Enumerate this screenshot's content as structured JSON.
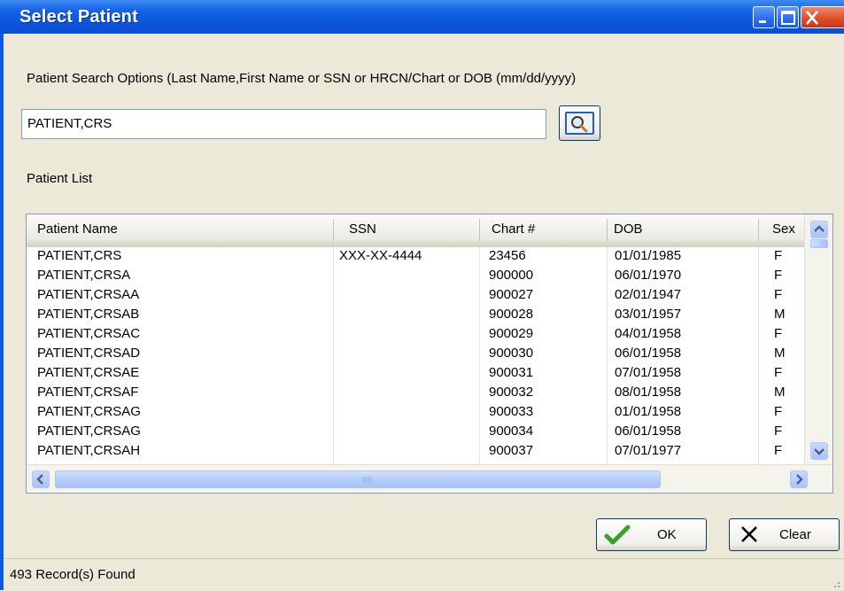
{
  "window": {
    "title": "Select Patient",
    "buttons": [
      "minimize-icon",
      "maximize-icon",
      "close-icon"
    ]
  },
  "search": {
    "options_label": "Patient Search Options (Last Name,First Name or SSN or HRCN/Chart or DOB (mm/dd/yyyy)",
    "value": "PATIENT,CRS",
    "button_icon": "magnifier-icon"
  },
  "list": {
    "label": "Patient List",
    "columns": [
      "Patient Name",
      "SSN",
      "Chart #",
      "DOB",
      "Sex"
    ],
    "rows": [
      {
        "name": "PATIENT,CRS",
        "ssn": "XXX-XX-4444",
        "chart": "23456",
        "dob": "01/01/1985",
        "sex": "F"
      },
      {
        "name": "PATIENT,CRSA",
        "ssn": "",
        "chart": "900000",
        "dob": "06/01/1970",
        "sex": "F"
      },
      {
        "name": "PATIENT,CRSAA",
        "ssn": "",
        "chart": "900027",
        "dob": "02/01/1947",
        "sex": "F"
      },
      {
        "name": "PATIENT,CRSAB",
        "ssn": "",
        "chart": "900028",
        "dob": "03/01/1957",
        "sex": "M"
      },
      {
        "name": "PATIENT,CRSAC",
        "ssn": "",
        "chart": "900029",
        "dob": "04/01/1958",
        "sex": "F"
      },
      {
        "name": "PATIENT,CRSAD",
        "ssn": "",
        "chart": "900030",
        "dob": "06/01/1958",
        "sex": "M"
      },
      {
        "name": "PATIENT,CRSAE",
        "ssn": "",
        "chart": "900031",
        "dob": "07/01/1958",
        "sex": "F"
      },
      {
        "name": "PATIENT,CRSAF",
        "ssn": "",
        "chart": "900032",
        "dob": "08/01/1958",
        "sex": "M"
      },
      {
        "name": "PATIENT,CRSAG",
        "ssn": "",
        "chart": "900033",
        "dob": "01/01/1958",
        "sex": "F"
      },
      {
        "name": "PATIENT,CRSAG",
        "ssn": "",
        "chart": "900034",
        "dob": "06/01/1958",
        "sex": "F"
      },
      {
        "name": "PATIENT,CRSAH",
        "ssn": "",
        "chart": "900037",
        "dob": "07/01/1977",
        "sex": "F"
      }
    ]
  },
  "actions": {
    "ok_label": "OK",
    "ok_icon": "checkmark-icon",
    "clear_label": "Clear",
    "clear_icon": "x-icon"
  },
  "status": {
    "text": "493 Record(s) Found"
  },
  "colors": {
    "titlebar": "#0a5ae0",
    "dialog_face": "#ece9d8",
    "close_button": "#dd4a25"
  }
}
